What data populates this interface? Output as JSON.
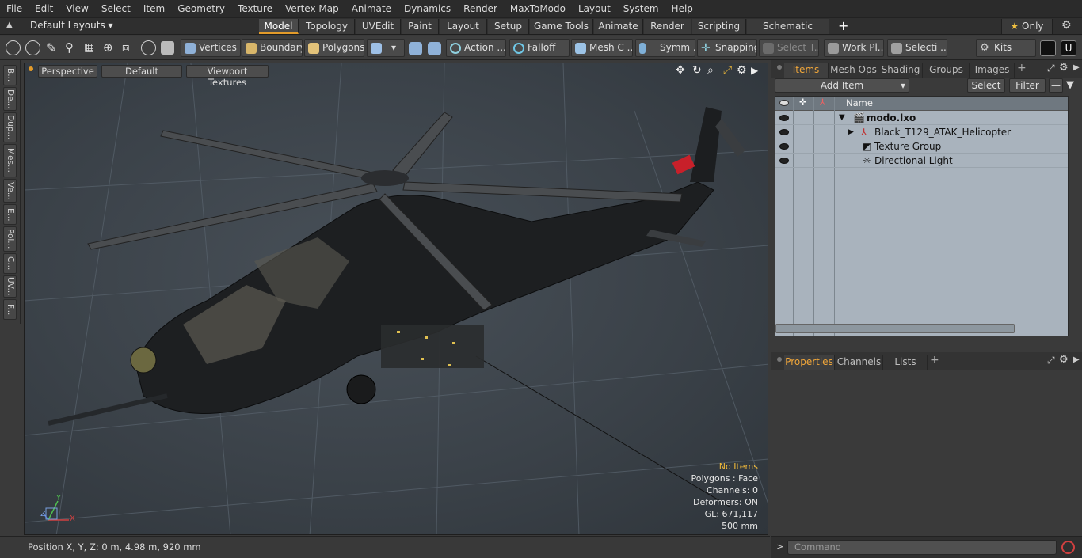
{
  "menu": [
    "File",
    "Edit",
    "View",
    "Select",
    "Item",
    "Geometry",
    "Texture",
    "Vertex Map",
    "Animate",
    "Dynamics",
    "Render",
    "MaxToModo",
    "Layout",
    "System",
    "Help"
  ],
  "layouts": {
    "label": "Default Layouts"
  },
  "mode_tabs": [
    "Model",
    "Topology",
    "UVEdit",
    "Paint",
    "Layout",
    "Setup",
    "Game Tools",
    "Animate",
    "Render",
    "Scripting",
    "Schematic Fusion"
  ],
  "only_label": "Only",
  "toolbar": {
    "vertices": "Vertices",
    "boundary": "Boundary",
    "polygons": "Polygons",
    "action": "Action ...",
    "falloff": "Falloff",
    "mesh": "Mesh C ...",
    "symm": "Symm ...",
    "snapping": "Snapping",
    "select_t": "Select T...",
    "workpl": "Work Pl...",
    "selecti": "Selecti ...",
    "kits": "Kits"
  },
  "left_tabs": [
    "B...",
    "De...",
    "Dup...",
    "Mes...",
    "Ve...",
    "E...",
    "Pol...",
    "C...",
    "UV...",
    "F..."
  ],
  "viewport": {
    "perspective": "Perspective",
    "default": "Default",
    "textures": "Viewport Textures",
    "stats": {
      "no_items": "No Items",
      "polygons": "Polygons : Face",
      "channels": "Channels: 0",
      "deformers": "Deformers: ON",
      "gl": "GL: 671,117",
      "scale": "500 mm"
    },
    "axis": {
      "x": "X",
      "y": "Y",
      "z": "Z"
    }
  },
  "status": {
    "position": "Position X, Y, Z:   0 m, 4.98 m, 920 mm"
  },
  "items_panel": {
    "tabs": [
      "Items",
      "Mesh Ops",
      "Shading",
      "Groups",
      "Images"
    ],
    "add_item": "Add Item",
    "select": "Select",
    "filter": "Filter",
    "col_name": "Name",
    "rows": [
      {
        "name": "modo.lxo"
      },
      {
        "name": "Black_T129_ATAK_Helicopter"
      },
      {
        "name": "Texture Group"
      },
      {
        "name": "Directional Light"
      }
    ]
  },
  "props_panel": {
    "tabs": [
      "Properties",
      "Channels",
      "Lists"
    ]
  },
  "command": {
    "placeholder": "Command"
  },
  "colors": {
    "accent": "#e39b2a",
    "tree_bg": "#a9b3bd"
  }
}
